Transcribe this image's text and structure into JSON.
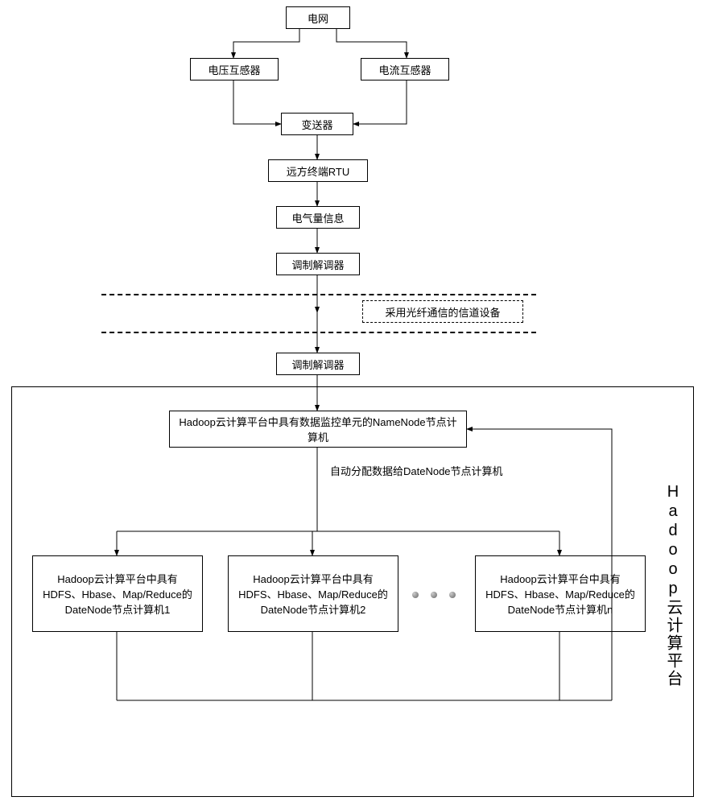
{
  "nodes": {
    "grid": "电网",
    "vt": "电压互感器",
    "ct": "电流互感器",
    "transmitter": "变送器",
    "rtu": "远方终端RTU",
    "elec_info": "电气量信息",
    "modem1": "调制解调器",
    "channel": "采用光纤通信的信道设备",
    "modem2": "调制解调器",
    "namenode": "Hadoop云计算平台中具有数据监控单元的NameNode节点计算机",
    "alloc_label": "自动分配数据给DateNode节点计算机",
    "datanode1": "Hadoop云计算平台中具有HDFS、Hbase、Map/Reduce的DateNode节点计算机1",
    "datanode2": "Hadoop云计算平台中具有HDFS、Hbase、Map/Reduce的DateNode节点计算机2",
    "datanoden": "Hadoop云计算平台中具有HDFS、Hbase、Map/Reduce的DateNode节点计算机n",
    "platform_label": "Hadoop云计算平台"
  }
}
